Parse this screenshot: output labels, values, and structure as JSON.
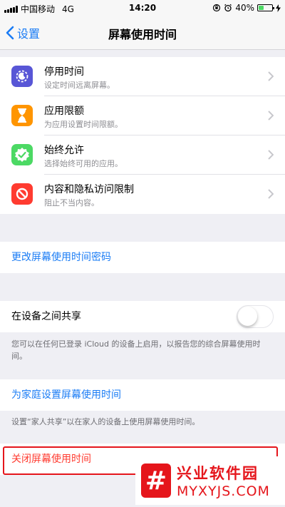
{
  "status_bar": {
    "carrier": "中国移动",
    "network": "4G",
    "time": "14:20",
    "battery": "40%",
    "battery_level": 0.4
  },
  "nav": {
    "back_label": "设置",
    "title": "屏幕使用时间"
  },
  "options": [
    {
      "title": "停用时间",
      "subtitle": "设定时间远离屏幕。",
      "icon": "downtime-icon",
      "color": "#5856d6"
    },
    {
      "title": "应用限额",
      "subtitle": "为应用设置时间限额。",
      "icon": "hourglass-icon",
      "color": "#ff9500"
    },
    {
      "title": "始终允许",
      "subtitle": "选择始终可用的应用。",
      "icon": "checkmark-icon",
      "color": "#4cd964"
    },
    {
      "title": "内容和隐私访问限制",
      "subtitle": "阻止不当内容。",
      "icon": "restriction-icon",
      "color": "#ff3b30"
    }
  ],
  "change_passcode": "更改屏幕使用时间密码",
  "share_across_devices": {
    "label": "在设备之间共享",
    "enabled": false,
    "footer": "您可以在任何已登录 iCloud 的设备上启用，以报告您的综合屏幕使用时间。"
  },
  "family": {
    "label": "为家庭设置屏幕使用时间",
    "footer": "设置“家人共享”以在家人的设备上使用屏幕使用时间。"
  },
  "turn_off": "关闭屏幕使用时间",
  "watermark": {
    "logo_char": "#",
    "name_cn": "兴业软件园",
    "name_en": "MYXYJS.COM"
  }
}
